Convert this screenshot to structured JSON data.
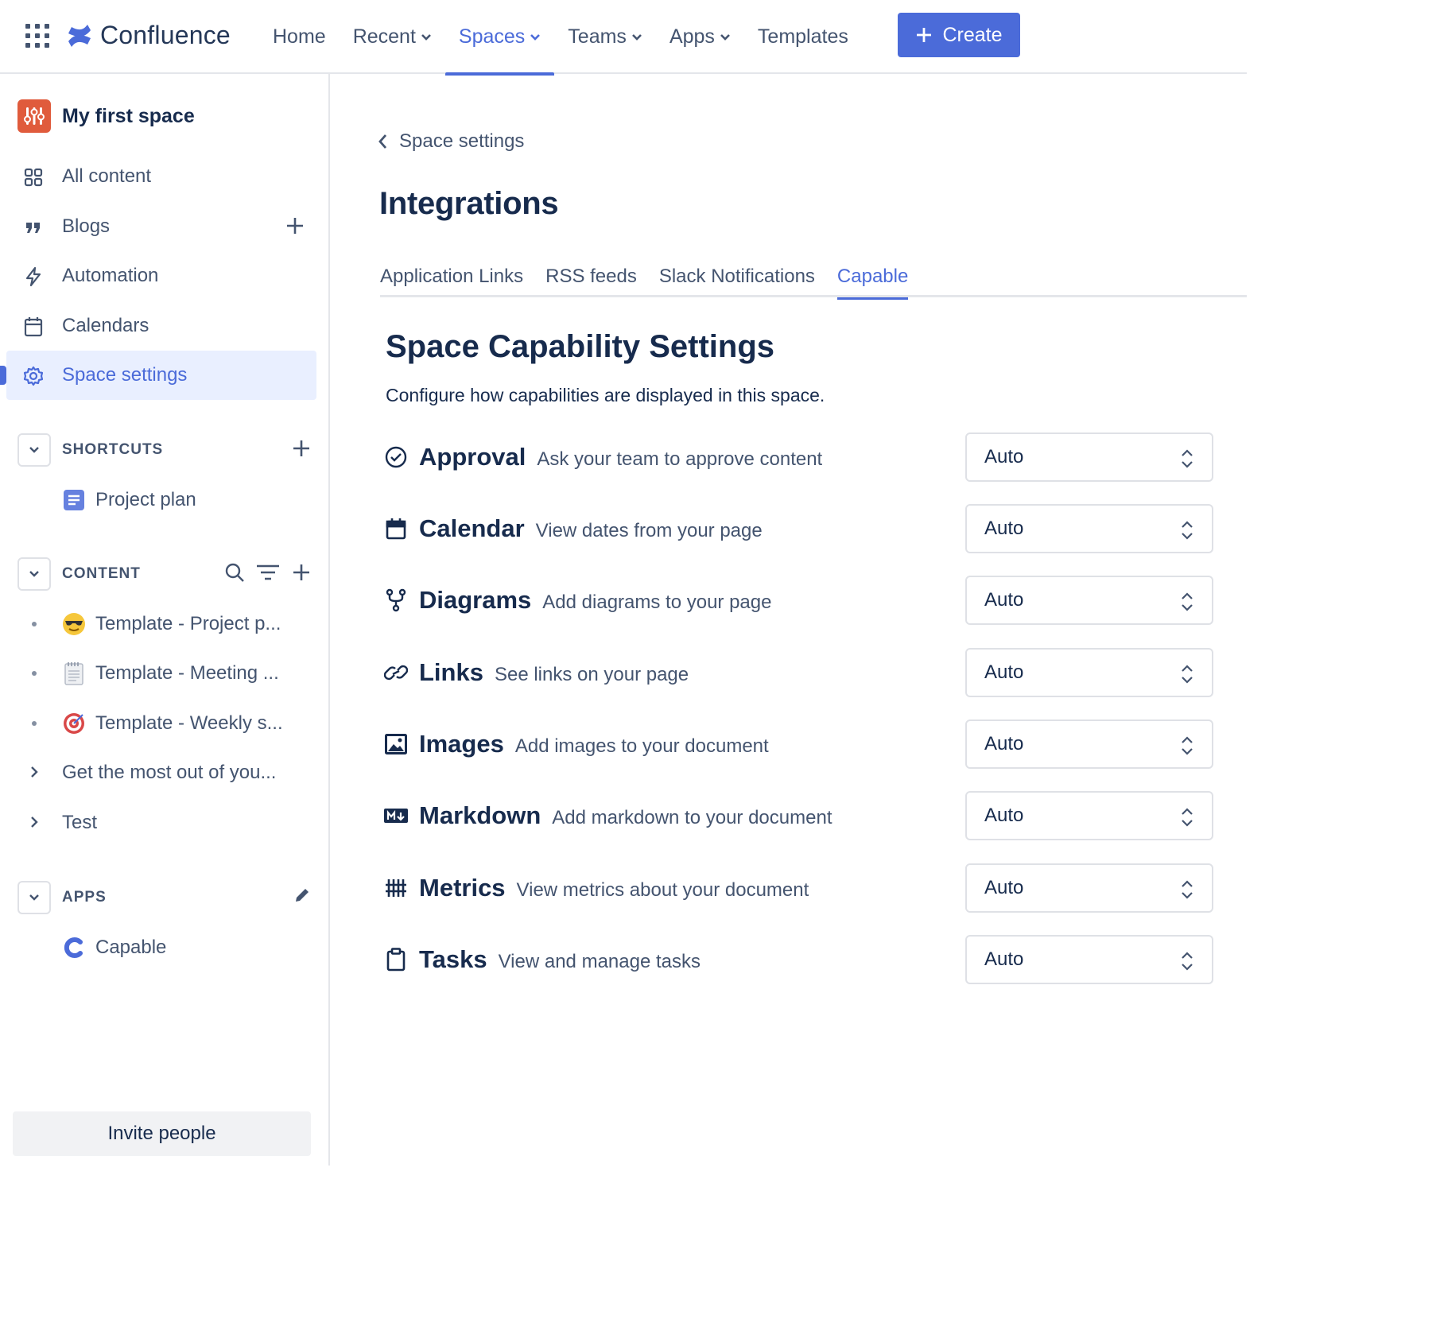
{
  "topbar": {
    "logo_text": "Confluence",
    "nav": [
      {
        "label": "Home",
        "dropdown": false,
        "active": false
      },
      {
        "label": "Recent",
        "dropdown": true,
        "active": false
      },
      {
        "label": "Spaces",
        "dropdown": true,
        "active": true
      },
      {
        "label": "Teams",
        "dropdown": true,
        "active": false
      },
      {
        "label": "Apps",
        "dropdown": true,
        "active": false
      },
      {
        "label": "Templates",
        "dropdown": false,
        "active": false
      }
    ],
    "create_label": "Create",
    "accent_color": "#4b6bd9"
  },
  "sidebar": {
    "space_name": "My first space",
    "items": [
      {
        "label": "All content",
        "icon": "grid-icon"
      },
      {
        "label": "Blogs",
        "icon": "quote-icon"
      },
      {
        "label": "Automation",
        "icon": "lightning-icon"
      },
      {
        "label": "Calendars",
        "icon": "calendar-icon"
      },
      {
        "label": "Space settings",
        "icon": "gear-icon"
      }
    ],
    "shortcuts": {
      "title": "SHORTCUTS",
      "items": [
        {
          "label": "Project plan",
          "icon": "document-icon"
        }
      ]
    },
    "content": {
      "title": "CONTENT",
      "items": [
        {
          "label": "Template - Project p...",
          "icon": "sunglasses-emoji"
        },
        {
          "label": "Template - Meeting ...",
          "icon": "notepad-emoji"
        },
        {
          "label": "Template - Weekly s...",
          "icon": "target-emoji"
        },
        {
          "label": "Get the most out of you...",
          "icon": "chevron-right-icon"
        },
        {
          "label": "Test",
          "icon": "chevron-right-icon"
        }
      ]
    },
    "apps": {
      "title": "APPS",
      "items": [
        {
          "label": "Capable",
          "icon": "capable-logo"
        }
      ]
    },
    "invite_label": "Invite people"
  },
  "main": {
    "back_label": "Space settings",
    "title": "Integrations",
    "tabs": [
      {
        "label": "Application Links",
        "active": false
      },
      {
        "label": "RSS feeds",
        "active": false
      },
      {
        "label": "Slack Notifications",
        "active": false
      },
      {
        "label": "Capable",
        "active": true
      }
    ],
    "capability_title": "Space Capability Settings",
    "capability_desc": "Configure how capabilities are displayed in this space.",
    "capabilities": [
      {
        "name": "Approval",
        "desc": "Ask your team to approve content",
        "value": "Auto",
        "icon": "check-circle-icon"
      },
      {
        "name": "Calendar",
        "desc": "View dates from your page",
        "value": "Auto",
        "icon": "calendar-icon"
      },
      {
        "name": "Diagrams",
        "desc": "Add diagrams to your page",
        "value": "Auto",
        "icon": "branch-icon"
      },
      {
        "name": "Links",
        "desc": "See links on your page",
        "value": "Auto",
        "icon": "link-icon"
      },
      {
        "name": "Images",
        "desc": "Add images to your document",
        "value": "Auto",
        "icon": "image-icon"
      },
      {
        "name": "Markdown",
        "desc": "Add markdown to your document",
        "value": "Auto",
        "icon": "markdown-icon"
      },
      {
        "name": "Metrics",
        "desc": "View metrics about your document",
        "value": "Auto",
        "icon": "metrics-icon"
      },
      {
        "name": "Tasks",
        "desc": "View and manage tasks",
        "value": "Auto",
        "icon": "clipboard-icon"
      }
    ]
  }
}
